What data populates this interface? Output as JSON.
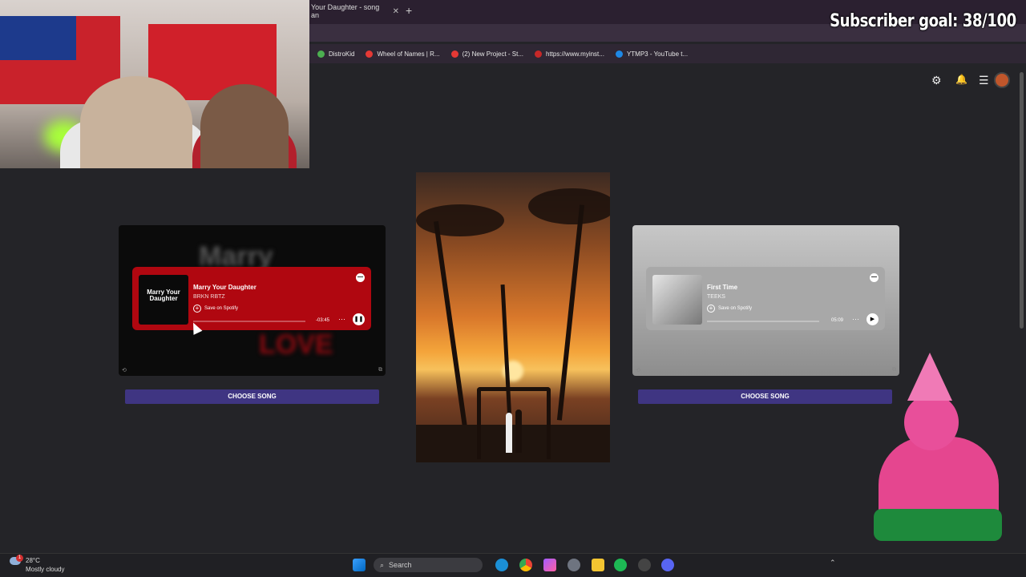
{
  "browser": {
    "tab_title": "Your Daughter - song an",
    "tab_close": "✕",
    "new_tab": "+",
    "bookmarks": [
      {
        "label": "DistroKid",
        "color": "#4caf50"
      },
      {
        "label": "Wheel of Names | R...",
        "color": "#e53935"
      },
      {
        "label": "(2) New Project - St...",
        "color": "#e53935"
      },
      {
        "label": "https://www.myinst...",
        "color": "#c62828"
      },
      {
        "label": "YTMP3 - YouTube t...",
        "color": "#1e88e5"
      }
    ]
  },
  "overlay": {
    "subscriber_goal": "Subscriber goal: 38/100"
  },
  "toolbar": {
    "settings_icon": "⚙",
    "bell_icon": "🔔",
    "menu_icon": "☰"
  },
  "cards": {
    "left": {
      "bg_text_top": "Marry",
      "bg_text_bottom": "LOVE",
      "cover_text": "Marry Your Daughter",
      "title": "Marry Your Daughter",
      "artist": "BRKN RBTZ",
      "save": "Save on Spotify",
      "time": "-03:45",
      "more": "···",
      "play_state": "❚❚",
      "choose": "CHOOSE SONG"
    },
    "right": {
      "title": "First Time",
      "artist": "TEEKS",
      "save": "Save on Spotify",
      "time": "05:09",
      "more": "···",
      "play_state": "▶",
      "choose": "CHOOSE SONG"
    }
  },
  "taskbar": {
    "temperature": "28°C",
    "weather": "Mostly cloudy",
    "search_placeholder": "Search",
    "badge": "1"
  }
}
